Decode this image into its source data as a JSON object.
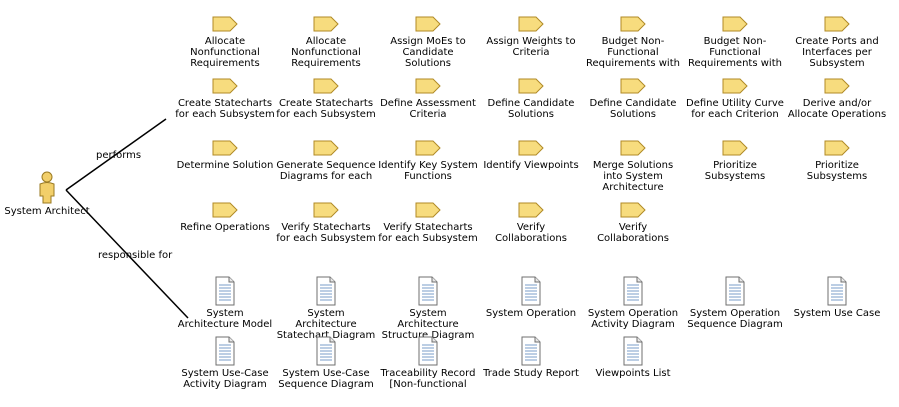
{
  "actor": {
    "name": "System Architect"
  },
  "relations": {
    "performs": "performs",
    "responsible_for": "responsible for"
  },
  "tasks": [
    [
      "Allocate Nonfunctional Requirements",
      "Allocate Nonfunctional Requirements",
      "Assign MoEs to Candidate Solutions",
      "Assign Weights to Criteria",
      "Budget Non-Functional Requirements with",
      "Budget Non-Functional Requirements with",
      "Create Ports and Interfaces per Subsystem"
    ],
    [
      "Create Statecharts for each Subsystem",
      "Create Statecharts for each Subsystem",
      "Define Assessment Criteria",
      "Define Candidate Solutions",
      "Define Candidate Solutions",
      "Define Utility Curve for each Criterion",
      "Derive and/or Allocate Operations"
    ],
    [
      "Determine Solution",
      "Generate Sequence Diagrams for each",
      "Identify Key System Functions",
      "Identify Viewpoints",
      "Merge Solutions into System Architecture",
      "Prioritize Subsystems",
      "Prioritize Subsystems"
    ],
    [
      "Refine Operations",
      "Verify Statecharts for each Subsystem",
      "Verify Statecharts for each Subsystem",
      "Verify Collaborations",
      "Verify Collaborations"
    ]
  ],
  "artifacts": [
    [
      "System Architecture Model",
      "System Architecture Statechart Diagram",
      "System Architecture Structure Diagram",
      "System Operation",
      "System Operation Activity Diagram",
      "System Operation Sequence Diagram",
      "System Use Case"
    ],
    [
      "System Use-Case Activity Diagram",
      "System Use-Case Sequence Diagram",
      "Traceability Record [Non-functional",
      "Trade Study Report",
      "Viewpoints List"
    ]
  ],
  "colors": {
    "task_fill": "#f7dc7e",
    "task_stroke": "#b08a26",
    "doc_stroke": "#6f6f6f",
    "doc_lines": "#7a9cc8",
    "actor_fill": "#f2cf6a"
  }
}
